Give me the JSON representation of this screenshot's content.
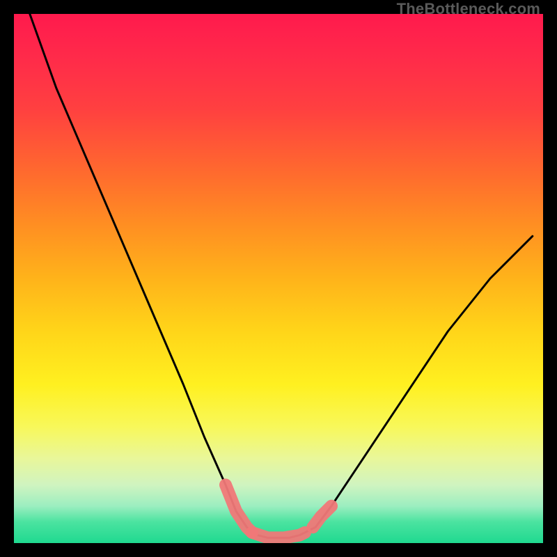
{
  "watermark": "TheBottleneck.com",
  "chart_data": {
    "type": "line",
    "title": "",
    "xlabel": "",
    "ylabel": "",
    "xlim": [
      0,
      100
    ],
    "ylim": [
      0,
      100
    ],
    "series": [
      {
        "name": "bottleneck-curve",
        "x": [
          3,
          8,
          14,
          20,
          26,
          32,
          36,
          40,
          42,
          44,
          46,
          48,
          50,
          52,
          54,
          57,
          60,
          66,
          74,
          82,
          90,
          98
        ],
        "y": [
          100,
          86,
          72,
          58,
          44,
          30,
          20,
          11,
          6,
          3,
          1.5,
          1,
          1,
          1,
          1.5,
          3,
          7,
          16,
          28,
          40,
          50,
          58
        ]
      }
    ],
    "highlight_segments": [
      {
        "name": "low-bottleneck-left",
        "x": [
          40,
          42,
          44,
          45
        ],
        "y": [
          11,
          6,
          3,
          2
        ]
      },
      {
        "name": "low-bottleneck-flat",
        "x": [
          45,
          48,
          51,
          54,
          55
        ],
        "y": [
          2,
          1,
          1,
          1.5,
          2
        ]
      },
      {
        "name": "low-bottleneck-right",
        "x": [
          56.5,
          58,
          60
        ],
        "y": [
          3,
          5,
          7
        ]
      }
    ],
    "colors": {
      "curve": "#000000",
      "highlight": "#f07878"
    }
  }
}
